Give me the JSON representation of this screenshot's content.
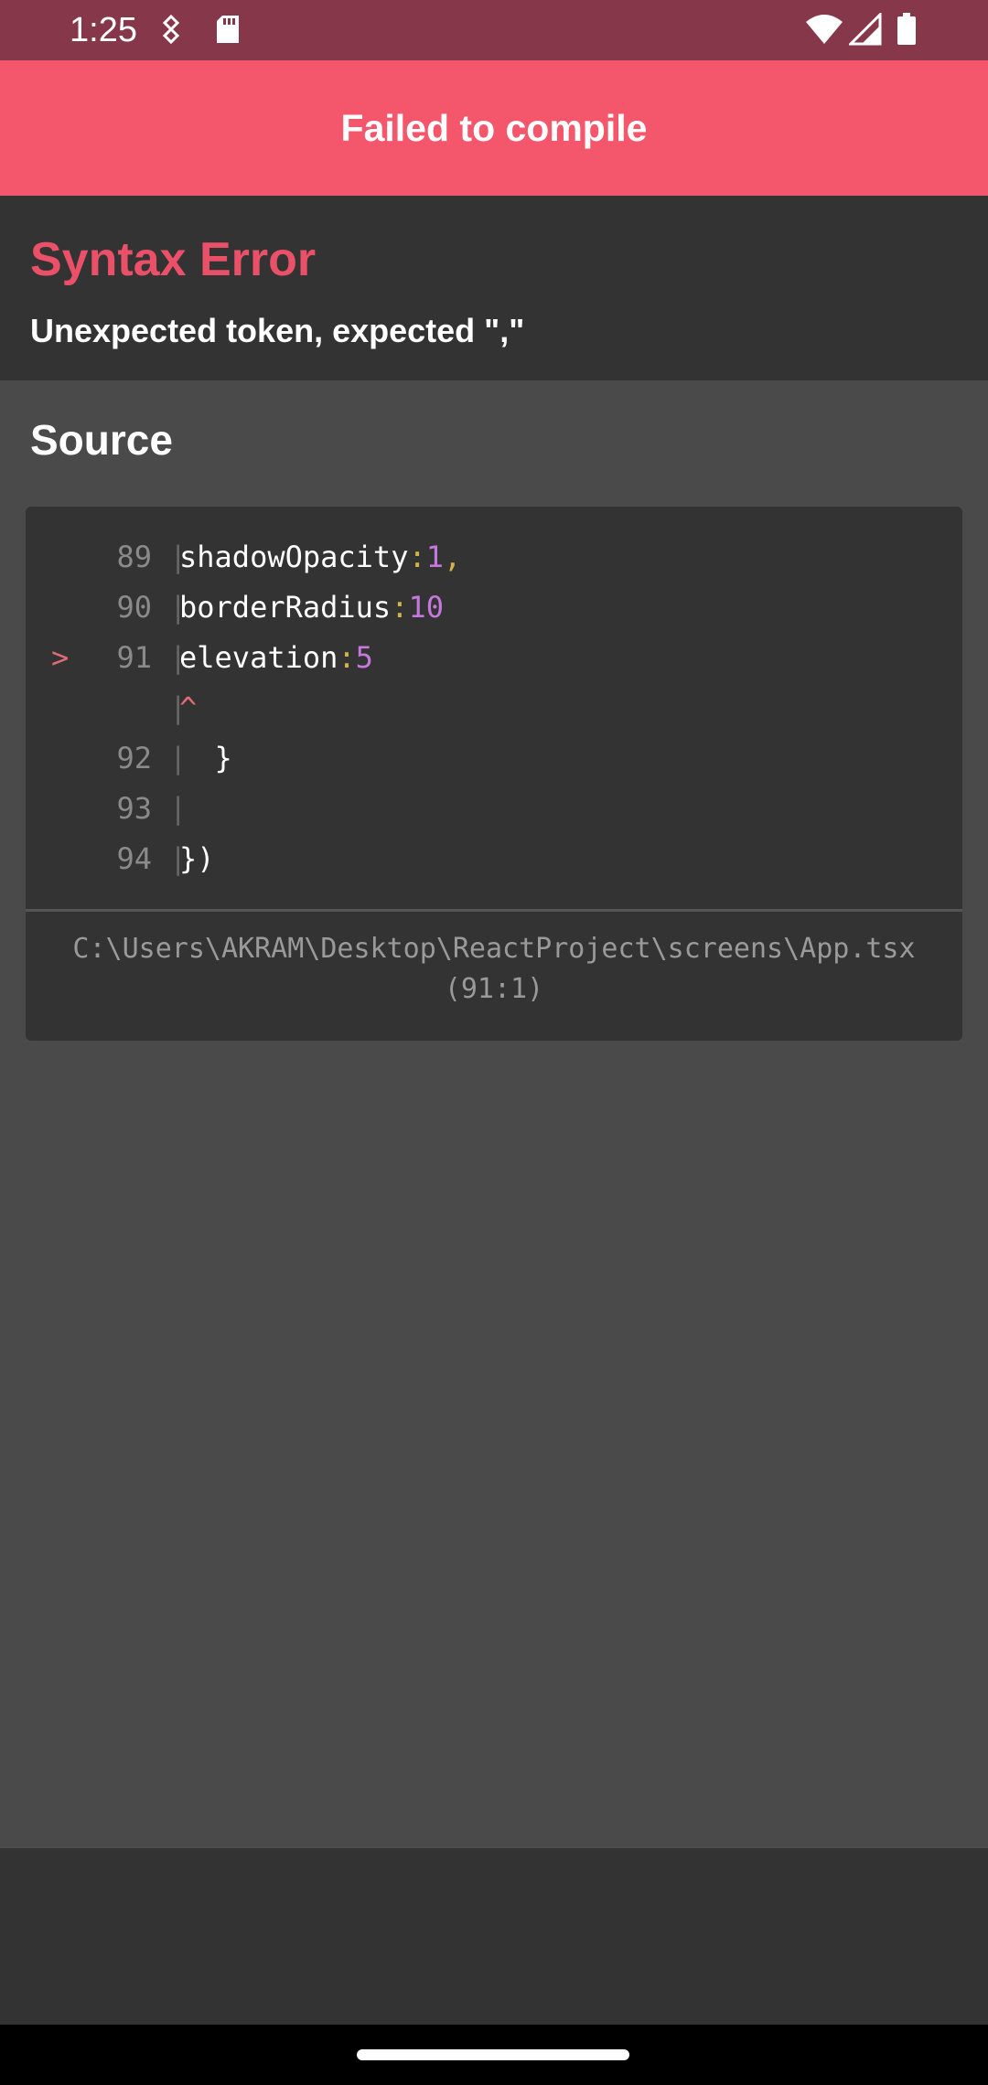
{
  "status_bar": {
    "time": "1:25",
    "icons": [
      "drone-icon",
      "sd-card-icon",
      "wifi-icon",
      "signal-icon",
      "battery-icon"
    ]
  },
  "header": {
    "title": "Failed to compile"
  },
  "error": {
    "title": "Syntax Error",
    "message": "Unexpected token, expected \",\""
  },
  "source": {
    "title": "Source",
    "lines": [
      {
        "marker": "",
        "num": "89",
        "key": "shadowOpacity",
        "colon": ":",
        "value": "1",
        "trail": ","
      },
      {
        "marker": "",
        "num": "90",
        "key": "borderRadius",
        "colon": ":",
        "value": "10",
        "trail": ""
      },
      {
        "marker": ">",
        "num": "91",
        "key": "elevation",
        "colon": ":",
        "value": "5",
        "trail": ""
      },
      {
        "marker": "",
        "num": "",
        "caret": "^"
      },
      {
        "marker": "",
        "num": "92",
        "plain": "  }"
      },
      {
        "marker": "",
        "num": "93",
        "plain": ""
      },
      {
        "marker": "",
        "num": "94",
        "plain": "})"
      }
    ],
    "pipe": "|",
    "file_path": "C:\\Users\\AKRAM\\Desktop\\ReactProject\\screens\\App.tsx",
    "location": "(91:1)"
  },
  "colors": {
    "status_bar": "#86374a",
    "header": "#f4566b",
    "error_title": "#ea5068",
    "panel": "#333333",
    "background": "#4a4a4a"
  }
}
